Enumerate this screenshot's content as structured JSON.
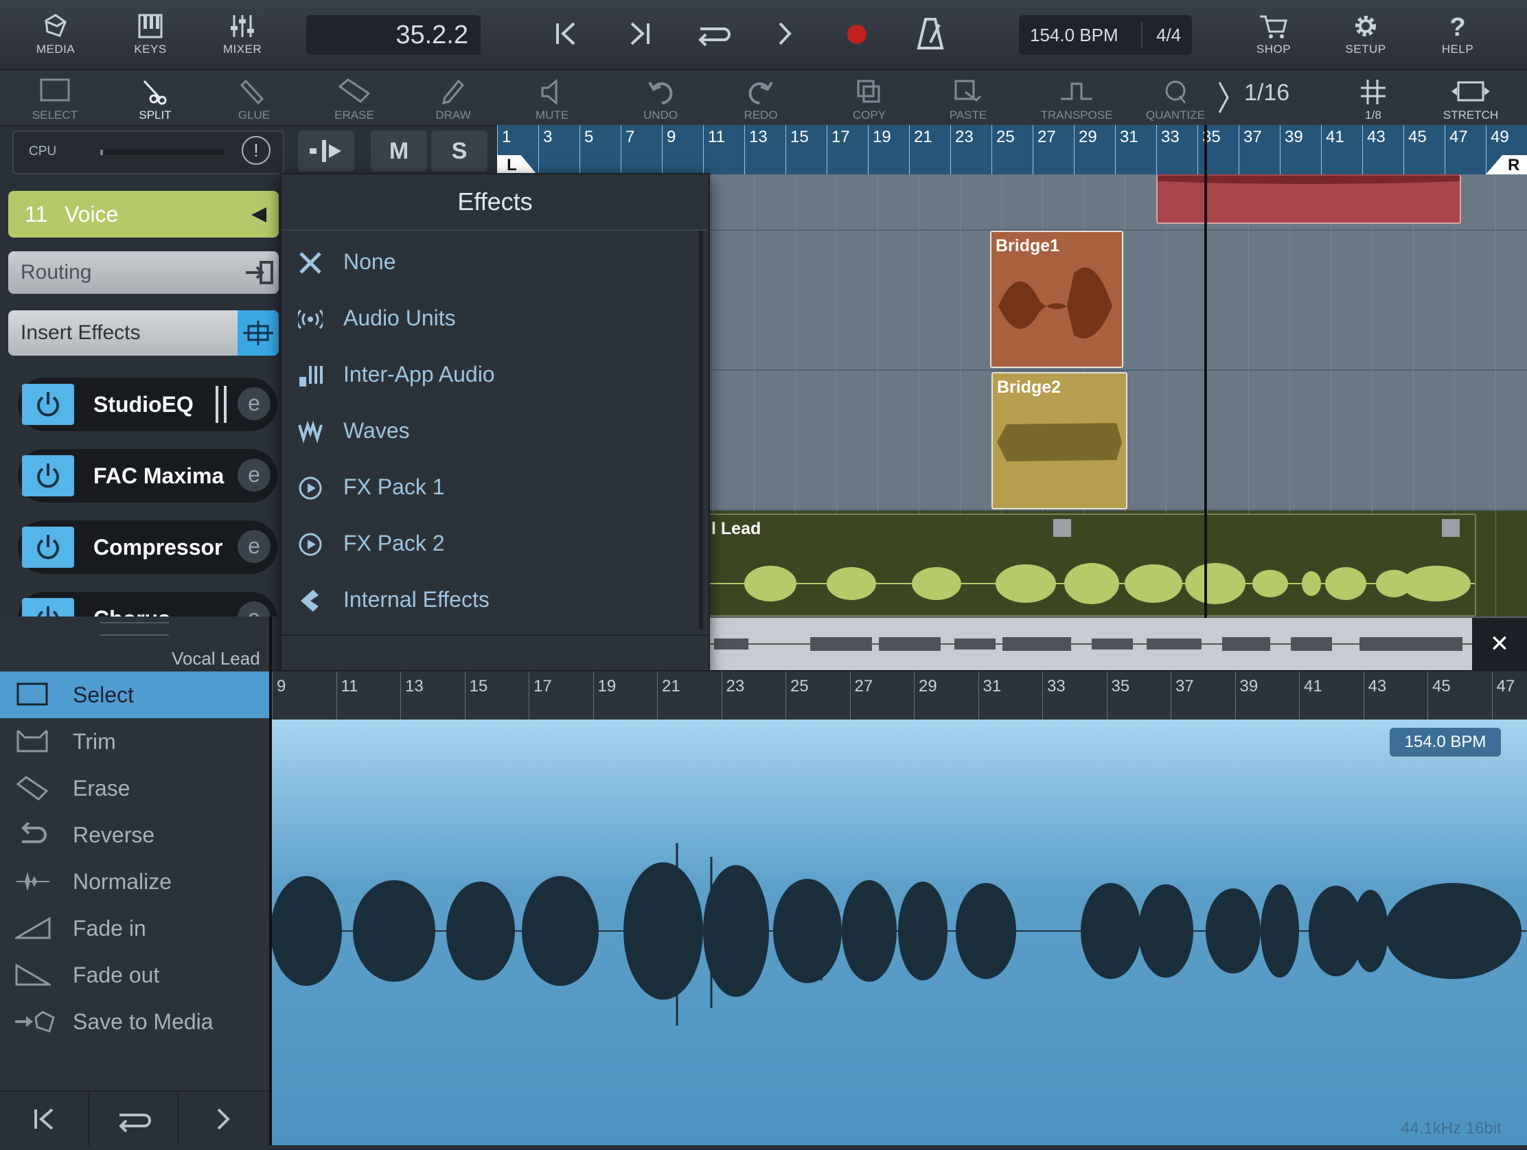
{
  "topbar": {
    "media": "MEDIA",
    "keys": "KEYS",
    "mixer": "MIXER",
    "position": "35.2.2",
    "tempo": "154.0 BPM",
    "signature": "4/4",
    "shop": "SHOP",
    "setup": "SETUP",
    "help": "HELP",
    "record_color": "#c0201e"
  },
  "tools": {
    "select": "SELECT",
    "split": "SPLIT",
    "glue": "GLUE",
    "erase": "ERASE",
    "draw": "DRAW",
    "mute": "MUTE",
    "undo": "UNDO",
    "redo": "REDO",
    "copy": "COPY",
    "paste": "PASTE",
    "transpose": "TRANSPOSE",
    "quantize": "QUANTIZE",
    "snap": "1/16",
    "grid": "1/8",
    "stretch": "STRETCH"
  },
  "inspector": {
    "cpu": "CPU",
    "cpu_alert": "!",
    "m": "M",
    "s": "S",
    "track_number": "11",
    "track_name": "Voice",
    "routing": "Routing",
    "insert_effects": "Insert Effects",
    "effects": [
      {
        "name": "StudioEQ",
        "edit": "e"
      },
      {
        "name": "FAC Maxima",
        "edit": "e"
      },
      {
        "name": "Compressor",
        "edit": "e"
      },
      {
        "name": "Chorus",
        "edit": "e"
      }
    ],
    "accent": "#55b4e8",
    "track_color": "#b4c96a"
  },
  "effects_menu": {
    "title": "Effects",
    "items": [
      {
        "label": "None",
        "icon": "x-icon"
      },
      {
        "label": "Audio Units",
        "icon": "audio-units-icon"
      },
      {
        "label": "Inter-App Audio",
        "icon": "inter-app-icon"
      },
      {
        "label": "Waves",
        "icon": "waves-icon"
      },
      {
        "label": "FX Pack 1",
        "icon": "fx-pack-icon"
      },
      {
        "label": "FX Pack 2",
        "icon": "fx-pack-icon"
      },
      {
        "label": "Internal Effects",
        "icon": "internal-effects-icon"
      }
    ]
  },
  "ruler": {
    "marks": [
      "1",
      "3",
      "5",
      "7",
      "9",
      "11",
      "13",
      "15",
      "17",
      "19",
      "21",
      "23",
      "25",
      "27",
      "29",
      "31",
      "33",
      "35",
      "37",
      "39",
      "41",
      "43",
      "45",
      "47",
      "49"
    ],
    "left_locator": "L",
    "right_locator": "R"
  },
  "clips": [
    {
      "name": "Bridge1",
      "color": "#a9603e"
    },
    {
      "name": "Bridge2",
      "color": "#b59e4f"
    },
    {
      "name": "l Lead",
      "color": "#3c4722"
    }
  ],
  "overview_close": "✕",
  "lower_ruler": {
    "marks": [
      "9",
      "11",
      "13",
      "15",
      "17",
      "19",
      "21",
      "23",
      "25",
      "27",
      "29",
      "31",
      "33",
      "35",
      "37",
      "39",
      "41",
      "43",
      "45",
      "47"
    ]
  },
  "edit_panel": {
    "track_name": "Vocal Lead",
    "items": [
      {
        "label": "Select",
        "selected": true
      },
      {
        "label": "Trim"
      },
      {
        "label": "Erase"
      },
      {
        "label": "Reverse"
      },
      {
        "label": "Normalize"
      },
      {
        "label": "Fade in"
      },
      {
        "label": "Fade out"
      },
      {
        "label": "Save to Media"
      }
    ]
  },
  "editor": {
    "bpm": "154.0 BPM",
    "sample_info": "44.1kHz  16bit"
  }
}
